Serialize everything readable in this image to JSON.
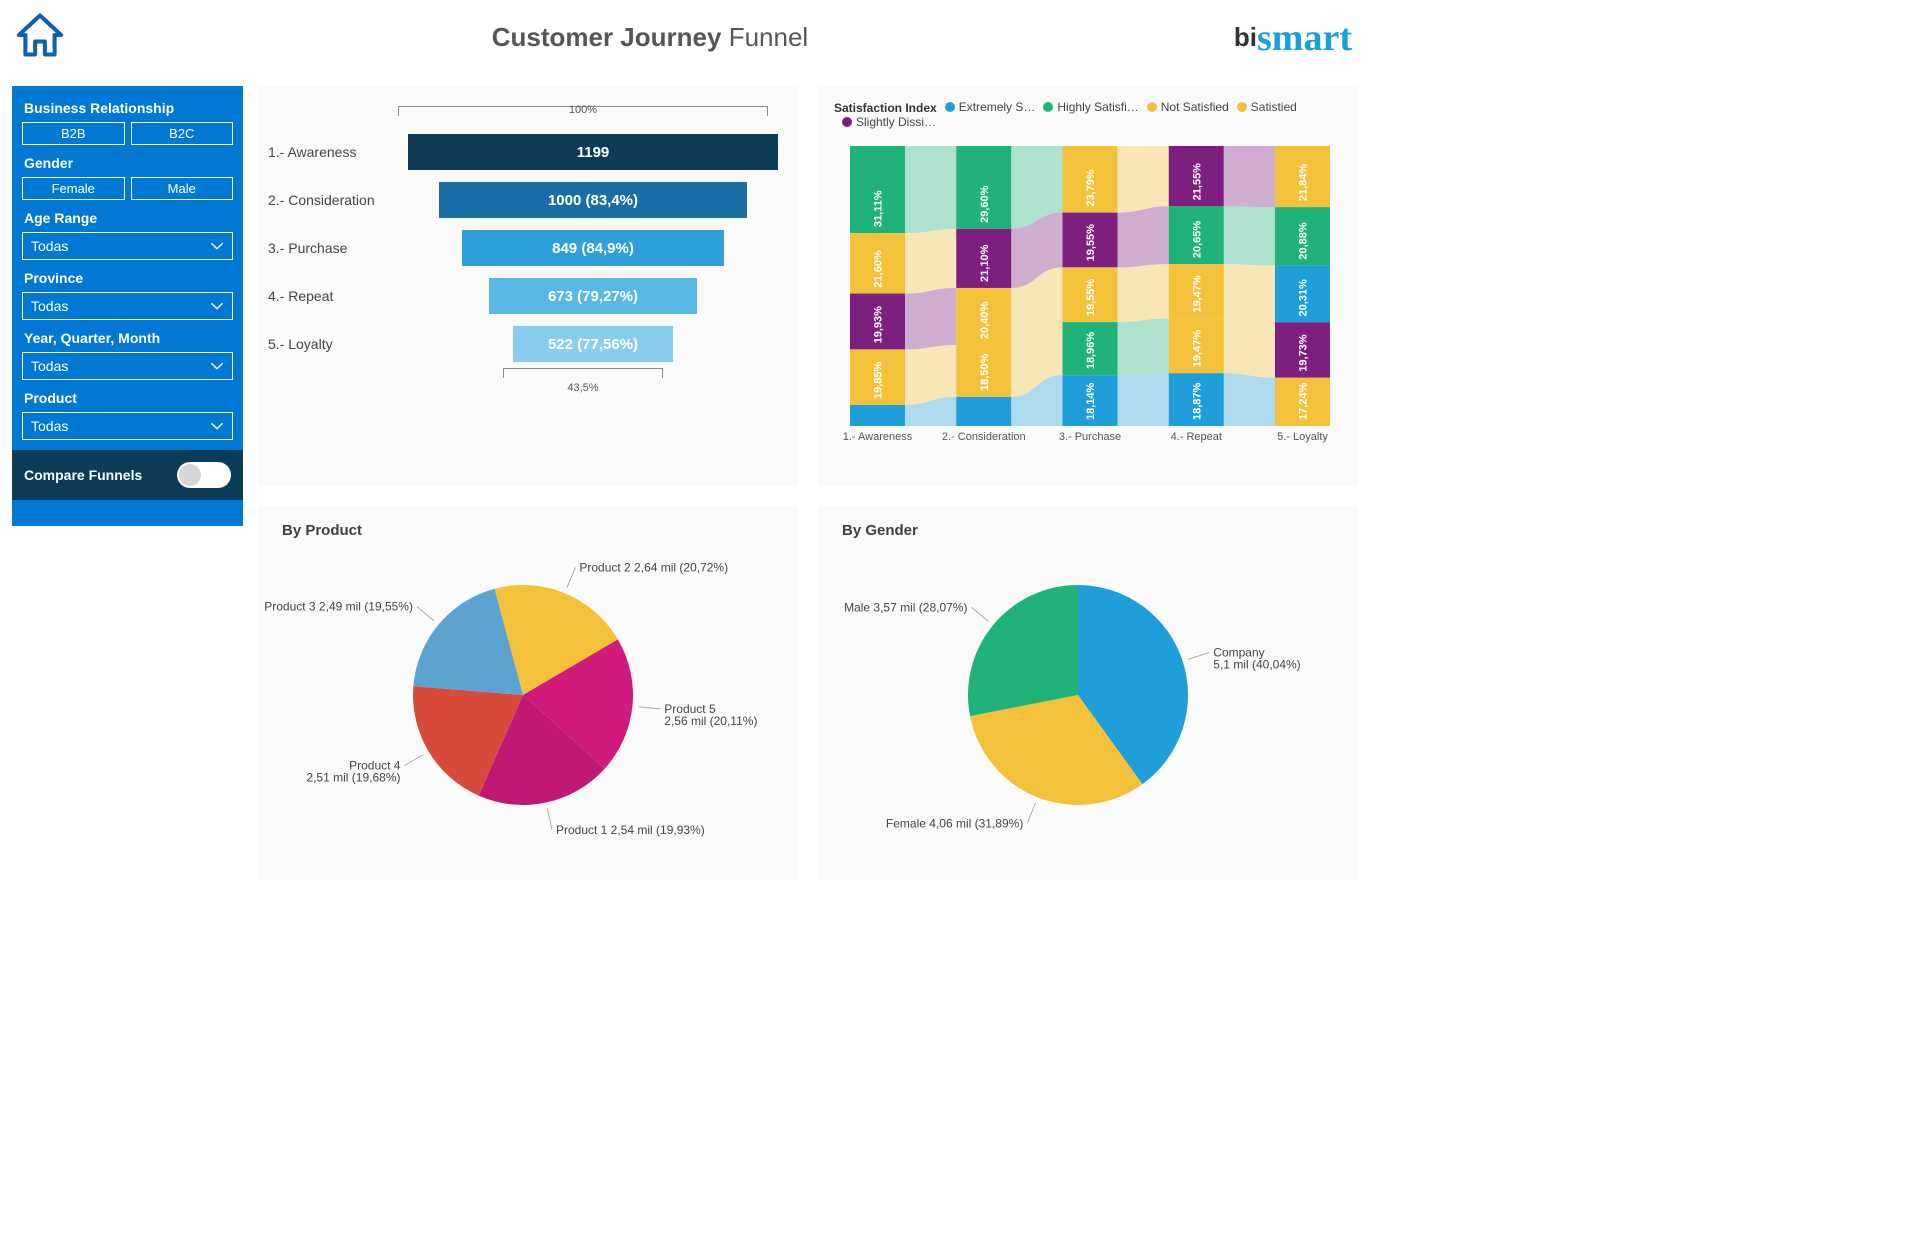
{
  "title": {
    "bold": "Customer Journey",
    "light": "Funnel"
  },
  "logo": {
    "bi": "bi",
    "smart": "smart"
  },
  "sidebar": {
    "businessRelationship": {
      "label": "Business Relationship",
      "btn1": "B2B",
      "btn2": "B2C"
    },
    "gender": {
      "label": "Gender",
      "btn1": "Female",
      "btn2": "Male"
    },
    "ageRange": {
      "label": "Age Range",
      "value": "Todas"
    },
    "province": {
      "label": "Province",
      "value": "Todas"
    },
    "period": {
      "label": "Year, Quarter, Month",
      "value": "Todas"
    },
    "product": {
      "label": "Product",
      "value": "Todas"
    },
    "compare": {
      "label": "Compare Funnels"
    }
  },
  "funnel": {
    "topPercent": "100%",
    "bottomPercent": "43,5%",
    "stages": [
      {
        "label": "1.- Awareness",
        "value": 1199,
        "display": "1199",
        "pct": 100,
        "color": "#0B3B57"
      },
      {
        "label": "2.- Consideration",
        "value": 1000,
        "display": "1000 (83,4%)",
        "pct": 83.4,
        "color": "#1A6EA5"
      },
      {
        "label": "3.- Purchase",
        "value": 849,
        "display": "849 (84,9%)",
        "pct": 70.8,
        "color": "#2E9FD9"
      },
      {
        "label": "4.- Repeat",
        "value": 673,
        "display": "673 (79,27%)",
        "pct": 56.1,
        "color": "#59B7E6"
      },
      {
        "label": "5.- Loyalty",
        "value": 522,
        "display": "522 (77,56%)",
        "pct": 43.5,
        "color": "#8ACCEE"
      }
    ]
  },
  "sankey": {
    "title": "Satisfaction Index",
    "legend": [
      {
        "name": "Extremely S…",
        "color": "#1E9FD9"
      },
      {
        "name": "Highly Satisfi…",
        "color": "#1FB37A"
      },
      {
        "name": "Not Satisfied",
        "color": "#F3C13A"
      },
      {
        "name": "Satistied",
        "color": "#F3C13A"
      },
      {
        "name": "Slightly Dissi…",
        "color": "#7E1E7E"
      }
    ],
    "xlabels": [
      "1.- Awareness",
      "2.- Consideration",
      "3.- Purchase",
      "4.- Repeat",
      "5.- Loyalty"
    ],
    "columns": [
      {
        "segments": [
          {
            "c": "#1FB37A",
            "t": "31,11%",
            "v": 31.11
          },
          {
            "c": "#F3C13A",
            "t": "21,60%",
            "v": 21.6
          },
          {
            "c": "#7E1E7E",
            "t": "19,93%",
            "v": 19.93
          },
          {
            "c": "#F3C13A",
            "t": "19,85%",
            "v": 19.85
          },
          {
            "c": "#1E9FD9",
            "t": "",
            "v": 7.51
          }
        ]
      },
      {
        "segments": [
          {
            "c": "#1FB37A",
            "t": "29,60%",
            "v": 29.6
          },
          {
            "c": "#7E1E7E",
            "t": "21,10%",
            "v": 21.1
          },
          {
            "c": "#F3C13A",
            "t": "20,40%",
            "v": 20.4
          },
          {
            "c": "#F3C13A",
            "t": "18,50%",
            "v": 18.5
          },
          {
            "c": "#1E9FD9",
            "t": "",
            "v": 10.4
          }
        ]
      },
      {
        "segments": [
          {
            "c": "#F3C13A",
            "t": "23,79%",
            "v": 23.79
          },
          {
            "c": "#7E1E7E",
            "t": "19,55%",
            "v": 19.55
          },
          {
            "c": "#F3C13A",
            "t": "19,55%",
            "v": 19.55
          },
          {
            "c": "#1FB37A",
            "t": "18,96%",
            "v": 18.96
          },
          {
            "c": "#1E9FD9",
            "t": "18,14%",
            "v": 18.14
          }
        ]
      },
      {
        "segments": [
          {
            "c": "#7E1E7E",
            "t": "21,55%",
            "v": 21.55
          },
          {
            "c": "#1FB37A",
            "t": "20,65%",
            "v": 20.65
          },
          {
            "c": "#F3C13A",
            "t": "19,47%",
            "v": 19.47
          },
          {
            "c": "#F3C13A",
            "t": "19,47%",
            "v": 19.47
          },
          {
            "c": "#1E9FD9",
            "t": "18,87%",
            "v": 18.87
          }
        ]
      },
      {
        "segments": [
          {
            "c": "#F3C13A",
            "t": "21,84%",
            "v": 21.84
          },
          {
            "c": "#1FB37A",
            "t": "20,88%",
            "v": 20.88
          },
          {
            "c": "#1E9FD9",
            "t": "20,31%",
            "v": 20.31
          },
          {
            "c": "#7E1E7E",
            "t": "19,73%",
            "v": 19.73
          },
          {
            "c": "#F3C13A",
            "t": "17,24%",
            "v": 17.24
          }
        ]
      }
    ]
  },
  "byProduct": {
    "title": "By Product",
    "slices": [
      {
        "name": "Product 2",
        "value": 2.64,
        "pct": 20.72,
        "label": "Product 2 2,64 mil (20,72%)",
        "color": "#F3C13A"
      },
      {
        "name": "Product 5",
        "value": 2.56,
        "pct": 20.11,
        "label": "Product 5\n2,56 mil (20,11%)",
        "color": "#D01B7C"
      },
      {
        "name": "Product 1",
        "value": 2.54,
        "pct": 19.93,
        "label": "Product 1 2,54 mil (19,93%)",
        "color": "#D01B7C"
      },
      {
        "name": "Product 4",
        "value": 2.51,
        "pct": 19.68,
        "label": "Product 4\n2,51 mil (19,68%)",
        "color": "#D84B3C"
      },
      {
        "name": "Product 3",
        "value": 2.49,
        "pct": 19.55,
        "label": "Product 3 2,49 mil (19,55%)",
        "color": "#5BA3D0"
      }
    ]
  },
  "byGender": {
    "title": "By Gender",
    "slices": [
      {
        "name": "Company",
        "value": 5.1,
        "pct": 40.04,
        "label": "Company\n5,1 mil (40,04%)",
        "color": "#1E9FD9"
      },
      {
        "name": "Female",
        "value": 4.06,
        "pct": 31.89,
        "label": "Female 4,06 mil (31,89%)",
        "color": "#F3C13A"
      },
      {
        "name": "Male",
        "value": 3.57,
        "pct": 28.07,
        "label": "Male 3,57 mil (28,07%)",
        "color": "#1FB37A"
      }
    ]
  },
  "chart_data": [
    {
      "type": "bar",
      "title": "Customer Journey Funnel",
      "categories": [
        "Awareness",
        "Consideration",
        "Purchase",
        "Repeat",
        "Loyalty"
      ],
      "values": [
        1199,
        1000,
        849,
        673,
        522
      ]
    },
    {
      "type": "heatmap",
      "title": "Satisfaction Index by Stage",
      "x": [
        "Awareness",
        "Consideration",
        "Purchase",
        "Repeat",
        "Loyalty"
      ],
      "series": [
        {
          "name": "Highly Satisfied",
          "values": [
            31.11,
            29.6,
            18.96,
            20.65,
            20.88
          ]
        },
        {
          "name": "Satisfied",
          "values": [
            21.6,
            20.4,
            19.55,
            19.47,
            21.84
          ]
        },
        {
          "name": "Slightly Dissatisfied",
          "values": [
            19.93,
            21.1,
            19.55,
            21.55,
            19.73
          ]
        },
        {
          "name": "Not Satisfied",
          "values": [
            19.85,
            18.5,
            23.79,
            19.47,
            17.24
          ]
        },
        {
          "name": "Extremely Satisfied",
          "values": [
            7.51,
            10.4,
            18.14,
            18.87,
            20.31
          ]
        }
      ]
    },
    {
      "type": "pie",
      "title": "By Product",
      "categories": [
        "Product 1",
        "Product 2",
        "Product 3",
        "Product 4",
        "Product 5"
      ],
      "values": [
        2.54,
        2.64,
        2.49,
        2.51,
        2.56
      ]
    },
    {
      "type": "pie",
      "title": "By Gender",
      "categories": [
        "Company",
        "Female",
        "Male"
      ],
      "values": [
        5.1,
        4.06,
        3.57
      ]
    }
  ]
}
